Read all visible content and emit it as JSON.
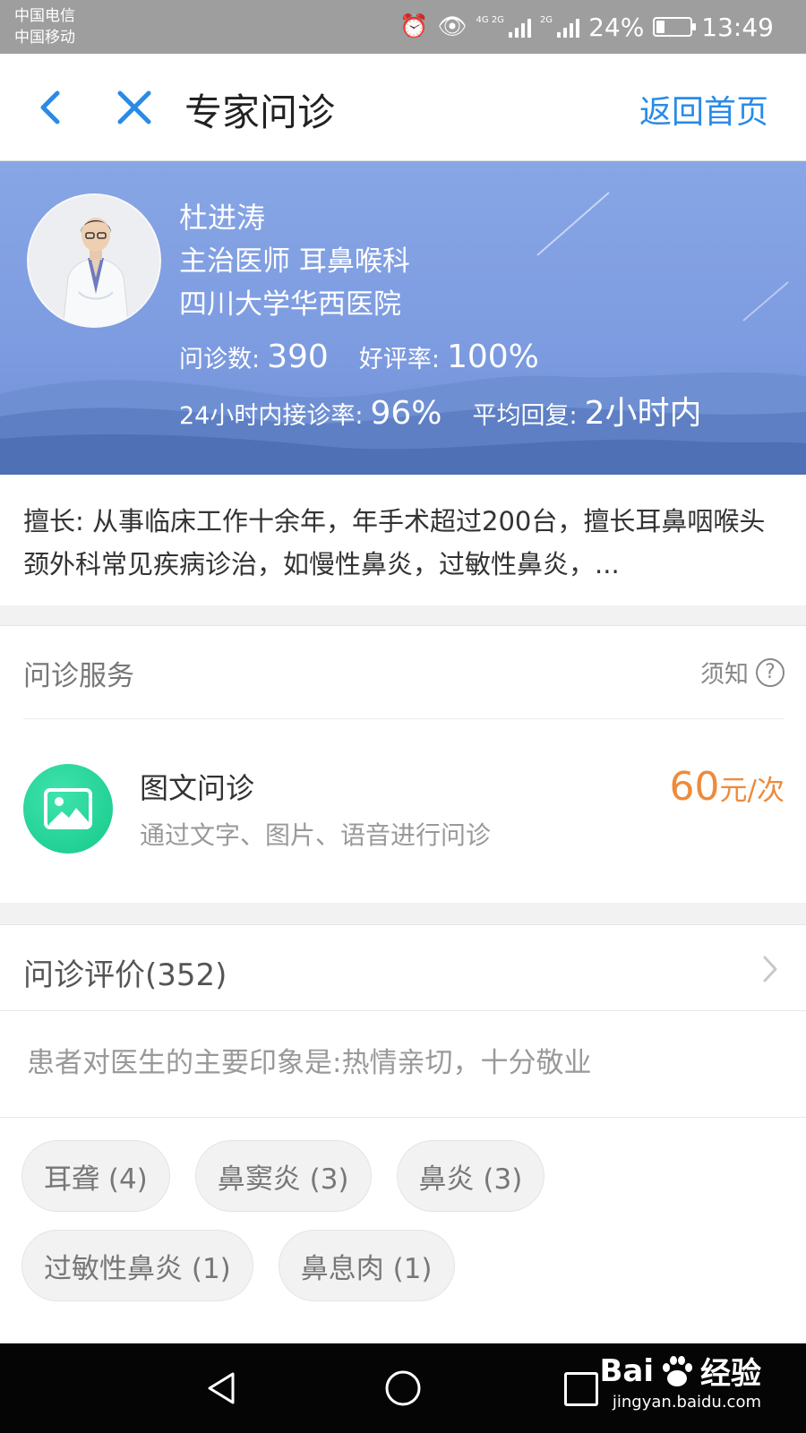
{
  "status_bar": {
    "carrier_1": "中国电信",
    "carrier_2": "中国移动",
    "net_1": "4G 2G",
    "net_2": "2G",
    "battery": "24%",
    "battery_level": 0.24,
    "time": "13:49"
  },
  "nav": {
    "title": "专家问诊",
    "home_link": "返回首页"
  },
  "doctor": {
    "name": "杜进涛",
    "title": "主治医师 耳鼻喉科",
    "hospital": "四川大学华西医院",
    "stats": {
      "consult_label": "问诊数:",
      "consult_value": "390",
      "rating_label": "好评率:",
      "rating_value": "100%",
      "accept_label": "24小时内接诊率:",
      "accept_value": "96%",
      "reply_label": "平均回复:",
      "reply_value": "2小时内"
    }
  },
  "expertise": {
    "text": "擅长: 从事临床工作十余年，年手术超过200台，擅长耳鼻咽喉头颈外科常见疾病诊治，如慢性鼻炎，过敏性鼻炎，..."
  },
  "service": {
    "header": "问诊服务",
    "notice_label": "须知",
    "item": {
      "name": "图文问诊",
      "description": "通过文字、图片、语音进行问诊",
      "price_amount": "60",
      "price_unit": "元/次"
    }
  },
  "reviews": {
    "title": "问诊评价(352)",
    "summary": "患者对医生的主要印象是:热情亲切，十分敬业",
    "tags": [
      "耳聋 (4)",
      "鼻窦炎 (3)",
      "鼻炎 (3)",
      "过敏性鼻炎 (1)",
      "鼻息肉 (1)"
    ]
  },
  "watermark": {
    "brand": "Bai",
    "brand_suffix": "经验",
    "url": "jingyan.baidu.com"
  },
  "colors": {
    "accent": "#2a8be6",
    "price": "#ef8a3a",
    "service_icon": "#22d495",
    "hero": "#7d9be0"
  }
}
